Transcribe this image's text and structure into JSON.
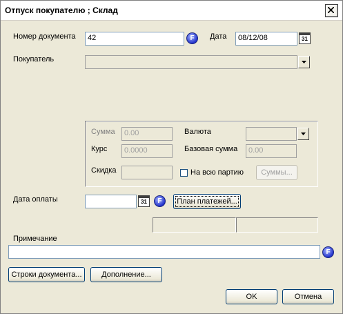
{
  "window": {
    "title": "Отпуск покупателю ; Склад"
  },
  "header": {
    "doc_number_label": "Номер документа",
    "doc_number_value": "42",
    "date_label": "Дата",
    "date_value": "08/12/08",
    "buyer_label": "Покупатель",
    "buyer_value": ""
  },
  "totals": {
    "sum_label": "Сумма",
    "sum_value": "0.00",
    "currency_label": "Валюта",
    "currency_value": "",
    "rate_label": "Курс",
    "rate_value": "0.0000",
    "base_sum_label": "Базовая сумма",
    "base_sum_value": "0.00",
    "discount_label": "Скидка",
    "discount_value": "",
    "whole_batch_label": "На всю партию",
    "sums_button": "Суммы..."
  },
  "payment": {
    "date_label": "Дата оплаты",
    "date_value": "",
    "plan_button": "План платежей..."
  },
  "note": {
    "label": "Примечание",
    "value": ""
  },
  "buttons": {
    "doc_lines": "Строки документа...",
    "extra": "Дополнение...",
    "ok": "OK",
    "cancel": "Отмена"
  },
  "icons": {
    "f_button": "F",
    "calendar_button": "31"
  },
  "colors": {
    "dialog_bg": "#ece9d8",
    "field_border": "#7f9db9",
    "button_border": "#003c74",
    "f_icon": "#2233cc"
  }
}
